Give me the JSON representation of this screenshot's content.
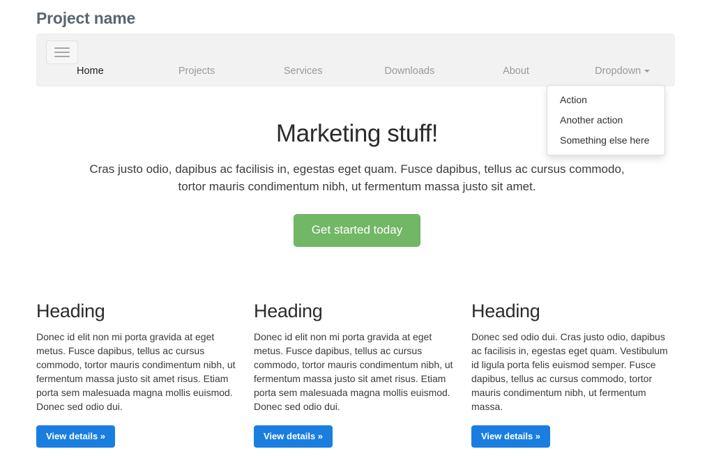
{
  "header": {
    "brand_title": "Project name"
  },
  "navbar": {
    "toggle_icon": "hamburger-menu-icon",
    "items": [
      {
        "label": "Home",
        "active": true
      },
      {
        "label": "Projects",
        "active": false
      },
      {
        "label": "Services",
        "active": false
      },
      {
        "label": "Downloads",
        "active": false
      },
      {
        "label": "About",
        "active": false
      },
      {
        "label": "Dropdown",
        "active": false,
        "has_caret": true,
        "caret_icon": "caret-down-icon"
      }
    ]
  },
  "dropdown": {
    "open": true,
    "items": [
      {
        "label": "Action"
      },
      {
        "label": "Another action"
      },
      {
        "label": "Something else here"
      }
    ]
  },
  "jumbotron": {
    "title": "Marketing stuff!",
    "lead": "Cras justo odio, dapibus ac facilisis in, egestas eget quam. Fusce dapibus, tellus ac cursus commodo, tortor mauris condimentum nibh, ut fermentum massa justo sit amet.",
    "cta_label": "Get started today",
    "cta_color": "#72b765"
  },
  "columns": [
    {
      "heading": "Heading",
      "body": "Donec id elit non mi porta gravida at eget metus. Fusce dapibus, tellus ac cursus commodo, tortor mauris condimentum nibh, ut fermentum massa justo sit amet risus. Etiam porta sem malesuada magna mollis euismod. Donec sed odio dui.",
      "button_label": "View details »"
    },
    {
      "heading": "Heading",
      "body": "Donec id elit non mi porta gravida at eget metus. Fusce dapibus, tellus ac cursus commodo, tortor mauris condimentum nibh, ut fermentum massa justo sit amet risus. Etiam porta sem malesuada magna mollis euismod. Donec sed odio dui.",
      "button_label": "View details »"
    },
    {
      "heading": "Heading",
      "body": "Donec sed odio dui. Cras justo odio, dapibus ac facilisis in, egestas eget quam. Vestibulum id ligula porta felis euismod semper. Fusce dapibus, tellus ac cursus commodo, tortor mauris condimentum nibh, ut fermentum massa.",
      "button_label": "View details »"
    }
  ],
  "colors": {
    "primary_button": "#1a7ee0",
    "cta_button": "#72b765",
    "navbar_background": "#f2f2f2",
    "brand_text": "#5a6570"
  }
}
